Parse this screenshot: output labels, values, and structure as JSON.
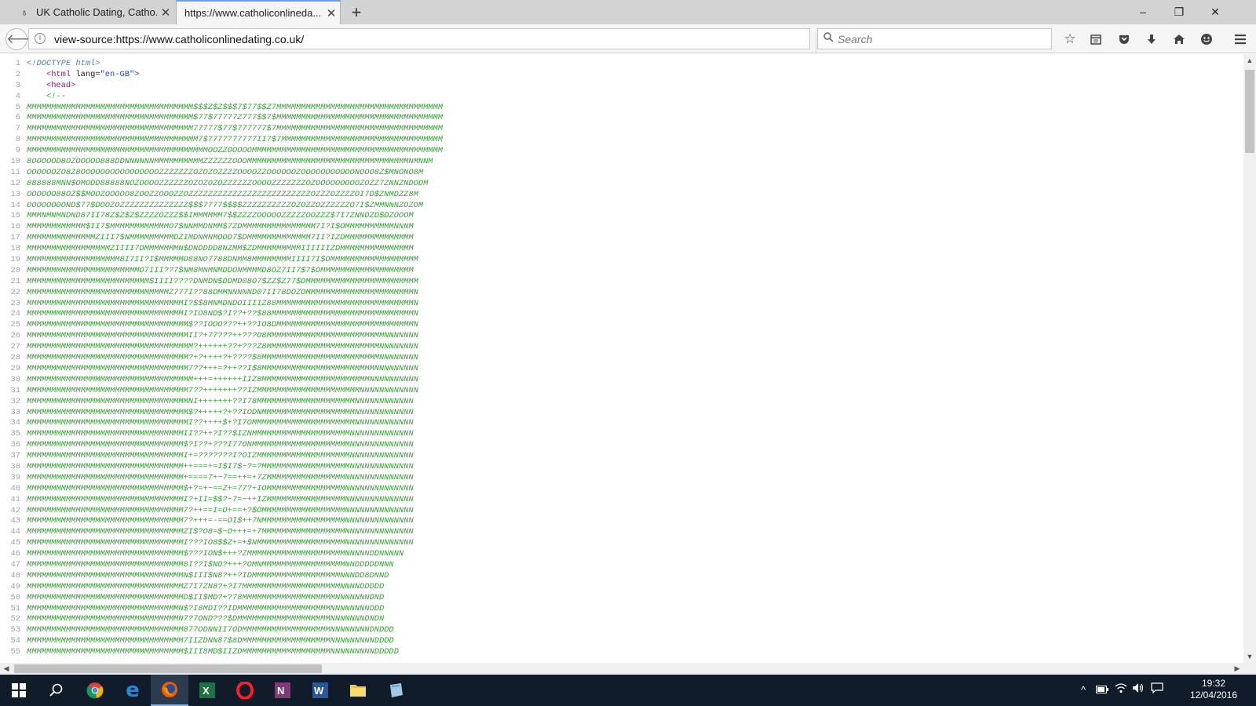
{
  "browser": {
    "tabs": [
      {
        "label": "UK Catholic Dating, Catho...",
        "favicon": "catholic-logo-icon",
        "active": false
      },
      {
        "label": "https://www.catholiconlineda...",
        "favicon": "",
        "active": true
      }
    ],
    "new_tab_label": "+",
    "window_controls": {
      "minimize": "–",
      "restore": "❐",
      "close": "✕"
    },
    "url": "view-source:https://www.catholiconlinedating.co.uk/",
    "search_placeholder": "Search",
    "toolbar_icons": [
      "star-icon",
      "reading-list-icon",
      "pocket-icon",
      "download-icon",
      "home-icon",
      "hello-icon",
      "menu-icon"
    ]
  },
  "source": {
    "doctype": "<!DOCTYPE html>",
    "html_open": {
      "tag_start": "<html ",
      "attr": "lang=",
      "value": "\"en-GB\"",
      "tag_end": ">"
    },
    "head_open": "<head>",
    "comment_open": "<!--",
    "art_lines": [
      "MMMMMMMMMMMMMMMMMMMMMMMMMMMMMMMMMM$$$Z$Z$$$7$77$$Z7MMMMMMMMMMMMMMMMMMMMMMMMMMMMMMMMMM",
      "MMMMMMMMMMMMMMMMMMMMMMMMMMMMMMMMMM$77$77777Z777$$7$MMMMMMMMMMMMMMMMMMMMMMMMMMMMMMMMMM",
      "MMMMMMMMMMMMMMMMMMMMMMMMMMMMMMMMMM77777$77$777777$7MMMMMMMMMMMMMMMMMMMMMMMMMMMMMMMMMM",
      "MMMMMMMMMMMMMMMMMMMMMMMMMMMMMMMMMMM7$7777777777II7$7MMMMMMMMMMMMMMMMMMMMMMMMMMMMMMMMM",
      "MMMMMMMMMMMMMMMMMMMMMMMMMMMMMMMMMMMMMOOZZOOOOOMMMMMMMMMMMMMMMMMMMMMMMMMMMMMMMMMMMMMMM",
      "8OOOOOD8OZOOOOO888DDNNNNNNMMMMMMMMMMZZZZZZOOOMMMMMMMMMMMMMMMMMMMMMMMMMMMMMMMMMNMNNM",
      "OOOOOOZO8Z8OOOOOOOOOOOOOOOOZZZZZZZOZOZOZZZZOOOOZZOOOOOOZOOOOOOOOOOONOOO8Z$MNONO8M",
      "888888MNN$OMODD88888NOZOOOOZZZZZZOZOZOZOZZZZZZOOOOZZZZZZZOZOOOOOOOOOZOZZ7ZNNZNDODM",
      "OOOOOO88OZ$$MOOZOOOOO8ZOOZZOOOZZOZZZZZZZZZZZZZZZZZZZZZZZZZOZZZOZZZZOI7D$ZNMDZZ8M",
      "OOOOOOOOND$77$DOOZOZZZZZZZZZZZZZZ$$$7777$$$$ZZZZZZZZZZOZOZZOZZZZZZO7I$ZMMNNNZOZOM",
      "MMMNMNMNDND87II78Z$Z$Z$ZZZZOZZZ$$IMMMMMM7$$ZZZZOOOOOZZZZZOOZZZ$7I7ZNNDZD$DZOOOM",
      "MMMMMMMMMMMM$II7$MMMMMMMMMMMMO7$NNMMDNMM$7ZDMMMMMMMMMMMMMMM7I?I$OMMMMMMMMMMNNNM",
      "MMMMMMMMMMMMMMZIII7$NMMMMMMMMMDZIMDNMNMOOD7$DMMMMMMMMMMMMM7II?IZDMMMMMMMMMMMMMM",
      "MMMMMMMMMMMMMMMMMZIIII7DMMMMMMMN$DNDDDD8NZMM$ZDMMMMMMMMMIIIIIIZDMMMMMMMMMMMMMMM",
      "MMMMMMMMMMMMMMMMMMM8I7II?I$MMMMMO88NO7788DNMM8MMMMMMMMIIII7I$OMMMMMMMMMMMMMMMMMM",
      "MMMMMMMMMMMMMMMMMMMMMMMO7III??7$NM8MNMNMDDONMMMMD8OZ7II7$7$OMMMMMMMMMMMMMMMMMMM",
      "MMMMMMMMMMMMMMMMMMMMMMMMM$IIII????DNMDN$DDMD08O7$ZZ$Z77$DMMMMMMMMMMMMMMMMMMMMMMM",
      "MMMMMMMMMMMMMMMMMMMMMMMMMMMMMZ777I??88DMMNNNNND07II78DOZOMMMMMMMMMMMMMMMMMMMMMMN",
      "MMMMMMMMMMMMMMMMMMMMMMMMMMMMMMMMI?$$8MNMDNDOIIIIZ88MMMMMMMMMMMMMMMMMMMMMMMMMMMMN",
      "MMMMMMMMMMMMMMMMMMMMMMMMMMMMMMMMI?IO8ND$?I??+??$88MMMMMMMMMMMMMMMMMMMMMMMMMMMMMN",
      "MMMMMMMMMMMMMMMMMMMMMMMMMMMMMMMMM$??IOOO???++??IO8DMMMMMMMMMMMMMMMMMMMMMMMMMMMMN",
      "MMMMMMMMMMMMMMMMMMMMMMMMMMMMMMMMMII?+77???++???O8MMMMMMMMMMMMMMMMMMMMMMMMNNNNNNN",
      "MMMMMMMMMMMMMMMMMMMMMMMMMMMMMMMMMM?++++++??+???Z8MMMMMMMMMMMMMMMMMMMMMMMNNNNNNNN",
      "MMMMMMMMMMMMMMMMMMMMMMMMMMMMMMMMM?+?++++?+????$8MMMMMMMMMMMMMMMMMMMMMMMMNNNNNNNN",
      "MMMMMMMMMMMMMMMMMMMMMMMMMMMMMMMMM7??+++=?++??I$8MMMMMMMMMMMMMMMMMMMMMMMNNNNNNNNN",
      "MMMMMMMMMMMMMMMMMMMMMMMMMMMMMMMMMM+++=++++++IIZ8MMMMMMMMMMMMMMMMMMMMMMNNNNNNNNNN",
      "MMMMMMMMMMMMMMMMMMMMMMMMMMMMMMMMM7??+++++++??IZMMMMMMMMMMMMMMMMMMMMMNNNNNNNNNNNN",
      "MMMMMMMMMMMMMMMMMMMMMMMMMMMMMMMMMNI+++++++??I78MMMMMMMMMMMMMMMMMMMMNNNNNNNNNNNN",
      "MMMMMMMMMMMMMMMMMMMMMMMMMMMMMMMMM$?+++++?+??IODNMMMMMMMMMMMMMMMMMMMNNNNNNNNNNNN",
      "MMMMMMMMMMMMMMMMMMMMMMMMMMMMMMMMMI??++++$+?I7OMMMMMMMMMMMMMMMMMMMMMNNNNNNNNNNNN",
      "MMMMMMMMMMMMMMMMMMMMMMMMMMMMMMMMII??++?I??$IZNMMMMMMMMMMMMMMMMMMMMNNNNNNNNNNNNN",
      "MMMMMMMMMMMMMMMMMMMMMMMMMMMMMMMM$?I??+???I77ONMMMMMMMMMMMMMMMMMMMMNNNNNNNNNNNNN",
      "MMMMMMMMMMMMMMMMMMMMMMMMMMMMMMMMI+=???????I?OIZMMMMMMMMMMMMMMMMMMMNNNNNNNNNNNNN",
      "MMMMMMMMMMMMMMMMMMMMMMMMMMMMMMMM++===+=I$I7$~?=?MMMMMMMMMMMMMMMMMMNNNNNNNNNNNNN",
      "MMMMMMMMMMMMMMMMMMMMMMMMMMMMMMMM+====7+~7==++=+7ZMMMMMMMMMMMMMMMMNNNNNNNNNNNNNN",
      "MMMMMMMMMMMMMMMMMMMMMMMMMMMMMMMM$+?=+~==Z+=77?+IOMMMMMMMMMMMMMMMMNNNNNNNNNNNNNN",
      "MMMMMMMMMMMMMMMMMMMMMMMMMMMMMMMMI?+II=$$?~7=~++IZMMMMMMMMMMMMMMMMNNNNNNNNNNNNNN",
      "MMMMMMMMMMMMMMMMMMMMMMMMMMMMMMMM7?++==I=O+==+?$OMMMMMMMMMMMMMMMMMNNNNNNNNNNNNNN",
      "MMMMMMMMMMMMMMMMMMMMMMMMMMMMMMMM7?+++=-==OI$++7NMMMMMMMMMMMMMMMMMNNNNNNNNNNNNNN",
      "MMMMMMMMMMMMMMMMMMMMMMMMMMMMMMMMZI$?O8=$~O+++=+7MMMMMMMMMMMMMMMMMNNNNNNNNNNNNNN",
      "MMMMMMMMMMMMMMMMMMMMMMMMMMMMMMMMI???IO8$$Z+=+$NMMMMMMMMMMMMMMMMMMNNNNNNNNNNNNNN",
      "MMMMMMMMMMMMMMMMMMMMMMMMMMMMMMMM$???ION$+++?ZMMMMMMMMMMMMMMMMMMMMNNNNNDDNNNNN",
      "MMMMMMMMMMMMMMMMMMMMMMMMMMMMMMMM8I??I$ND?+++?OMNMMMMMMMMMMMMMMMMMNNDDDDDNNN",
      "MMMMMMMMMMMMMMMMMMMMMMMMMMMMMMMMN$III$N8?++?IDMMMMMMMMMMMMMMMMMMNNNDD8DNND",
      "MMMMMMMMMMMMMMMMMMMMMMMMMMMMMMMMZ7I7ZN8?+?I7MMMMMMMMMMMMMMMMMMMMNNNNDDDDD",
      "MMMMMMMMMMMMMMMMMMMMMMMMMMMMMMMMD$II$MD?+?78MMMMMMMMMMMMMMMMMMMNNNNNNNDND",
      "MMMMMMMMMMMMMMMMMMMMMMMMMMMMMMMN$?I8MDI??IDMMMMMMMMMMMMMMMMMMMNNNNNNNNDDD",
      "MMMMMMMMMMMMMMMMMMMMMMMMMMMMMMMN7?7OND???$DMMMMMMMMMMMMMMMMMMMNNNNNNNDNDN",
      "MMMMMMMMMMMMMMMMMMMMMMMMMMMMMMMM877ODNNII7ODMMMMMMMMMMMMMMMMMMNNNNNNNNDNDDD",
      "MMMMMMMMMMMMMMMMMMMMMMMMMMMMMMMM7IIZDNN87$8DMMMMMMMMMMMMMMMMMMNNNNNNNNNDDDD",
      "MMMMMMMMMMMMMMMMMMMMMMMMMMMMMMMM$III8MD$IIZDMMMMMMMMMMMMMMMMMMNNNNNNNNNDDDDD"
    ]
  },
  "taskbar": {
    "apps": [
      "windows-start-icon",
      "search-icon",
      "chrome-icon",
      "edge-icon",
      "firefox-icon",
      "excel-icon",
      "opera-icon",
      "onenote-icon",
      "word-icon",
      "file-explorer-icon",
      "notes-app-icon"
    ],
    "clock_time": "19:32",
    "clock_date": "12/04/2016"
  },
  "colors": {
    "comment": "#3a9a3a",
    "doctype": "#4a7cb8",
    "tag": "#7a1a7a",
    "attr_value": "#1c3cc9",
    "taskbar": "#101c2a"
  }
}
